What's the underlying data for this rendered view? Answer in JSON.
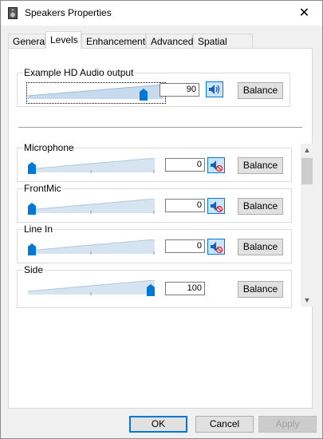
{
  "window": {
    "title": "Speakers Properties",
    "close_glyph": "✕"
  },
  "tabs": [
    "General",
    "Levels",
    "Enhancements",
    "Advanced",
    "Spatial sound"
  ],
  "active_tab": "Levels",
  "master": {
    "label": "Example HD Audio output",
    "value": "90",
    "level": 0.9,
    "muted": false,
    "balance_label": "Balance"
  },
  "channels": [
    {
      "label": "Microphone",
      "value": "0",
      "level": 0.0,
      "muted": true,
      "balance_label": "Balance"
    },
    {
      "label": "FrontMic",
      "value": "0",
      "level": 0.0,
      "muted": true,
      "balance_label": "Balance"
    },
    {
      "label": "Line In",
      "value": "0",
      "level": 0.0,
      "muted": true,
      "balance_label": "Balance"
    },
    {
      "label": "Side",
      "value": "100",
      "level": 1.0,
      "muted": false,
      "balance_label": "Balance"
    }
  ],
  "buttons": {
    "ok": "OK",
    "cancel": "Cancel",
    "apply": "Apply"
  },
  "scrollbar": {
    "up_glyph": "▲",
    "down_glyph": "▼"
  },
  "colors": {
    "accent": "#0078d7",
    "slider_track": "#c7d9ec",
    "mute_red": "#e81123"
  }
}
